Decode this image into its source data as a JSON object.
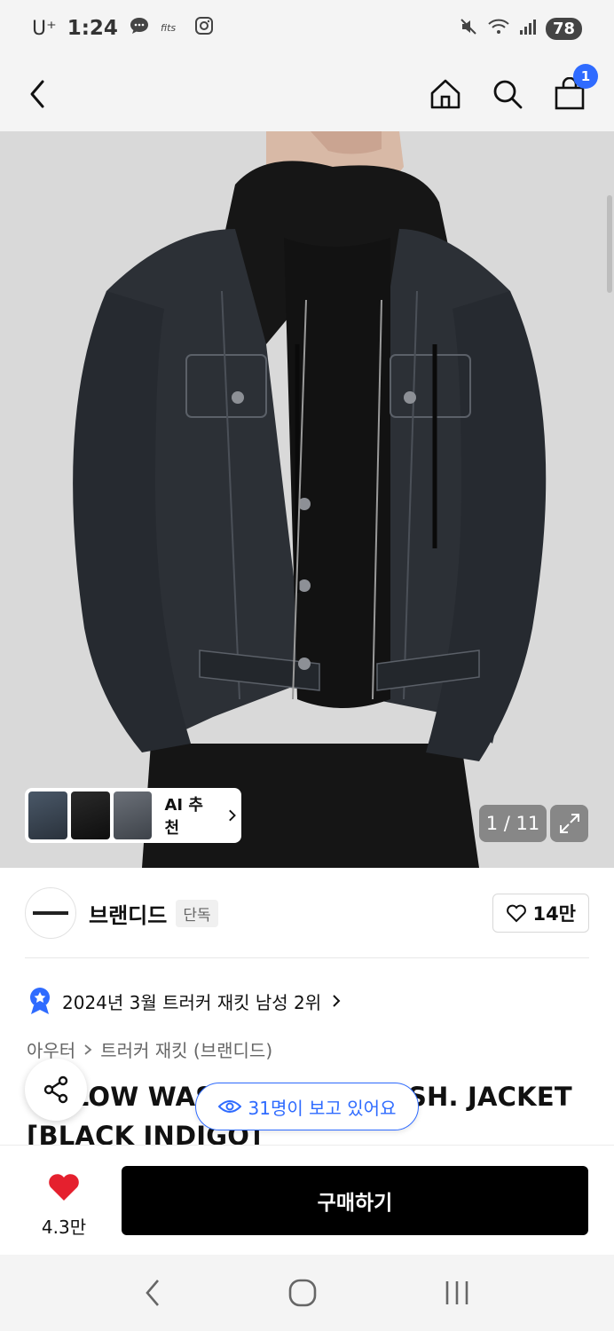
{
  "status_bar": {
    "carrier": "U⁺",
    "time": "1:24",
    "battery": "78"
  },
  "top_nav": {
    "cart_count": "1"
  },
  "gallery": {
    "ai_label": "AI 추천",
    "counter": "1 / 11"
  },
  "brand": {
    "name": "브랜디드",
    "tag": "단독",
    "likes": "14만"
  },
  "ranking": {
    "text": "2024년 3월 트러커 재킷 남성 2위"
  },
  "breadcrumb": {
    "category": "아우터",
    "subcategory": "트러커 재킷 (브랜디드)"
  },
  "product": {
    "title": "1 SLOW WASH. DENIM WASH. JACKET [BLACK INDIGO]"
  },
  "viewers": {
    "text": "31명이 보고 있어요"
  },
  "bottom": {
    "wish_count": "4.3만",
    "buy_label": "구매하기"
  },
  "colors": {
    "accent": "#2f6bff",
    "heart": "#e5202e",
    "buy": "#000000"
  }
}
